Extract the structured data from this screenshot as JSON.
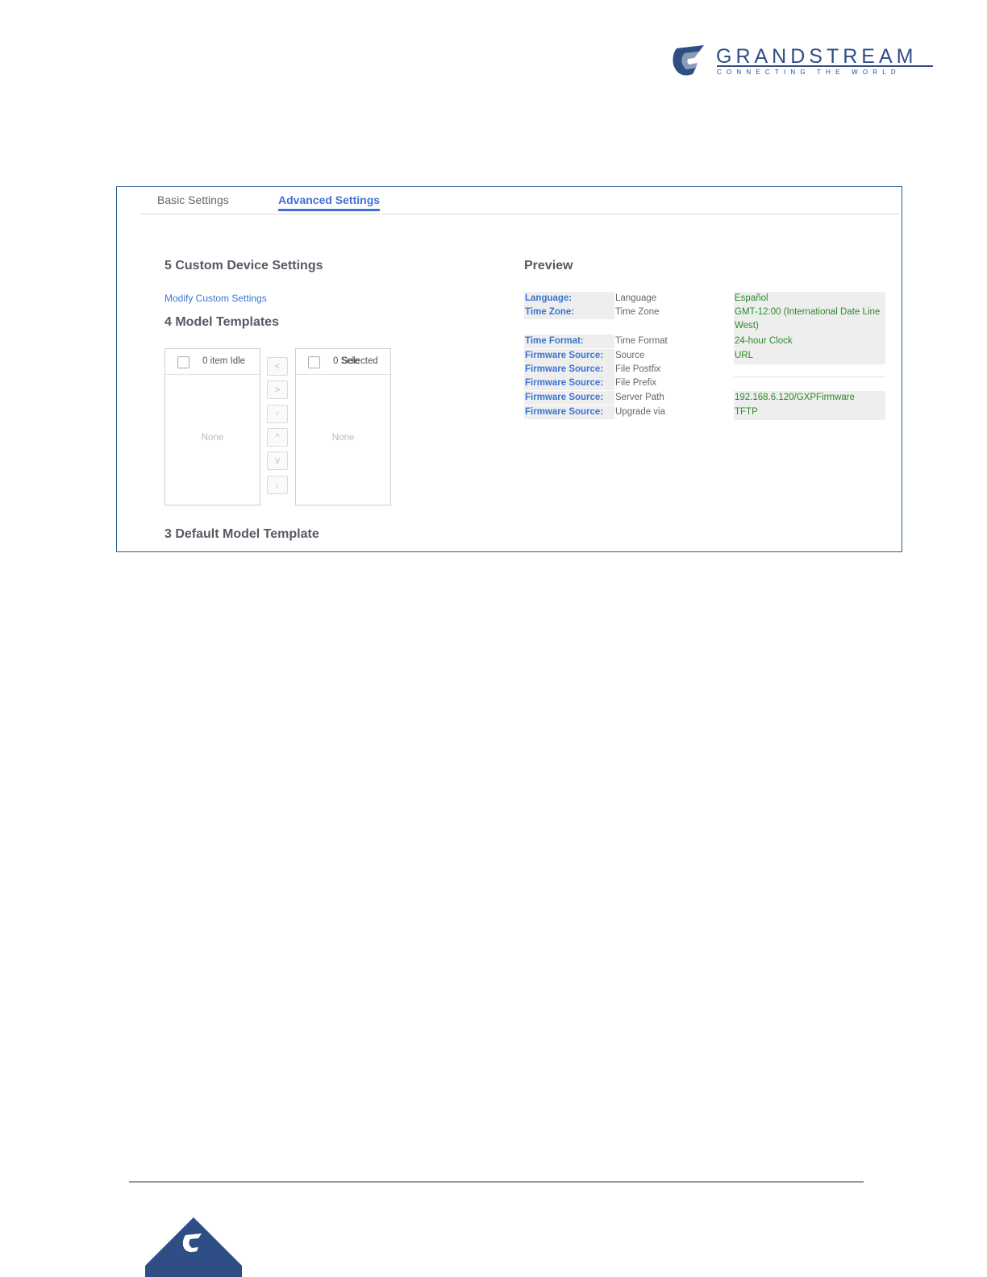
{
  "brand": {
    "name": "GRANDSTREAM",
    "tagline": "CONNECTING THE WORLD"
  },
  "tabs": {
    "basic": "Basic Settings",
    "advanced": "Advanced Settings"
  },
  "sections": {
    "custom": "5 Custom Device Settings",
    "modify_link": "Modify Custom Settings",
    "templates": "4 Model Templates",
    "default_template": "3 Default Model Template",
    "preview": "Preview"
  },
  "transfer": {
    "left_title": "0 item Idle",
    "right_title": "0 Sele",
    "right_title_overlap": "Selected",
    "left_empty": "None",
    "right_empty": "None",
    "controls": [
      "<",
      ">",
      "↑",
      "^",
      "v",
      "↓"
    ]
  },
  "preview": [
    {
      "key": "Language:",
      "label": "Language",
      "value": "Español"
    },
    {
      "key": "Time Zone:",
      "label": "Time Zone",
      "value": "GMT-12:00 (International Date Line West)"
    },
    {
      "key": "Time Format:",
      "label": "Time Format",
      "value": "24-hour Clock"
    },
    {
      "key": "Firmware Source:",
      "label": "Source",
      "value": "URL"
    },
    {
      "key": "Firmware Source:",
      "label": "File Postfix",
      "value": ""
    },
    {
      "key": "Firmware Source:",
      "label": "File Prefix",
      "value": ""
    },
    {
      "key": "Firmware Source:",
      "label": "Server Path",
      "value": "192.168.6.120/GXPFirmware"
    },
    {
      "key": "Firmware Source:",
      "label": "Upgrade via",
      "value": "TFTP"
    }
  ],
  "colors": {
    "brand_blue": "#2f4e86",
    "accent": "#3f6fd6",
    "value_green": "#2d8a2d",
    "frame_border": "#2b5f8e"
  }
}
